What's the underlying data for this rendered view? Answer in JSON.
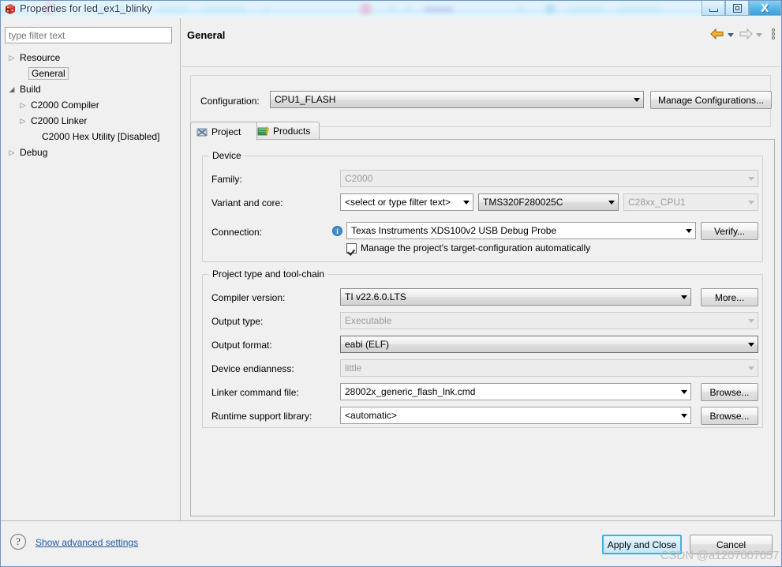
{
  "window": {
    "title": "Properties for led_ex1_blinky",
    "icon": "properties-cube-icon",
    "buttons": {
      "minimize": "minimize-icon",
      "restore": "restore-icon",
      "close": "X"
    }
  },
  "sidebar": {
    "filter_placeholder": "type filter text",
    "filter_value": "",
    "items": [
      {
        "label": "Resource",
        "twisty": "▷",
        "indent": 0,
        "selected": false
      },
      {
        "label": "General",
        "twisty": "",
        "indent": 1,
        "selected": true
      },
      {
        "label": "Build",
        "twisty": "◢",
        "indent": 0,
        "selected": false
      },
      {
        "label": "C2000 Compiler",
        "twisty": "▷",
        "indent": 1,
        "selected": false
      },
      {
        "label": "C2000 Linker",
        "twisty": "▷",
        "indent": 1,
        "selected": false
      },
      {
        "label": "C2000 Hex Utility  [Disabled]",
        "twisty": "",
        "indent": 2,
        "selected": false
      },
      {
        "label": "Debug",
        "twisty": "▷",
        "indent": 0,
        "selected": false
      }
    ]
  },
  "header": {
    "title": "General",
    "back_icon": "back-arrow-icon",
    "forward_icon": "forward-arrow-icon",
    "menu_icon": "vertical-dots-menu-icon"
  },
  "configuration": {
    "label": "Configuration:",
    "value": "CPU1_FLASH",
    "manage_label": "Manage Configurations..."
  },
  "tabs": [
    {
      "label": "Project",
      "icon": "project-icon",
      "active": true
    },
    {
      "label": "Products",
      "icon": "products-books-icon",
      "active": false
    }
  ],
  "device_group": {
    "title": "Device",
    "rows": [
      {
        "label": "Family:",
        "value": "C2000",
        "state": "disabled"
      },
      {
        "label": "Variant and core:",
        "value": "<select or type filter text>",
        "state": "normal"
      }
    ],
    "variant_value": "TMS320F280025C",
    "variant_state": "shaded",
    "core_value": "C28xx_CPU1",
    "core_state": "disabled",
    "connection_label": "Connection:",
    "connection_value": "Texas Instruments XDS100v2 USB Debug Probe",
    "connection_info_icon": "info-icon",
    "verify_label": "Verify...",
    "manage_target_checkbox": {
      "label": "Manage the project's target-configuration automatically",
      "checked": true
    }
  },
  "toolchain_group": {
    "title": "Project type and tool-chain",
    "rows": [
      {
        "label": "Compiler version:",
        "value": "TI v22.6.0.LTS",
        "state": "shaded",
        "button": "More..."
      },
      {
        "label": "Output type:",
        "value": "Executable",
        "state": "disabled",
        "button": ""
      },
      {
        "label": "Output format:",
        "value": "eabi (ELF)",
        "state": "shaded",
        "button": ""
      },
      {
        "label": "Device endianness:",
        "value": "little",
        "state": "disabled",
        "button": ""
      },
      {
        "label": "Linker command file:",
        "value": "28002x_generic_flash_lnk.cmd",
        "state": "normal",
        "button": "Browse..."
      },
      {
        "label": "Runtime support library:",
        "value": "<automatic>",
        "state": "normal",
        "button": "Browse..."
      }
    ]
  },
  "footer": {
    "help_icon": "help-question-icon",
    "advanced_link": "Show advanced settings",
    "apply_label": "Apply and Close",
    "cancel_label": "Cancel"
  },
  "watermark": "CSDN @a1207607057",
  "colors": {
    "accent": "#37b3e8",
    "link": "#2159a5",
    "info": "#3f8fd0",
    "titlebar": "#dff2fd",
    "panel": "#f0f0f0"
  }
}
